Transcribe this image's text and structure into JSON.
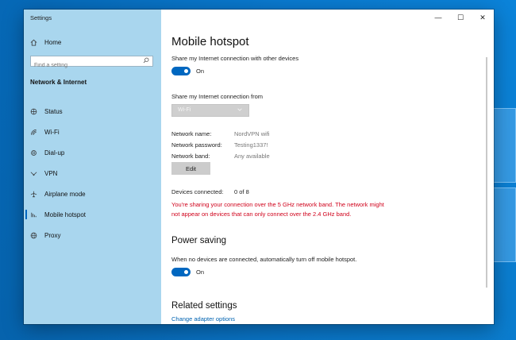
{
  "window": {
    "app_title": "Settings",
    "caption": {
      "minimize": "—",
      "maximize": "☐",
      "close": "✕"
    }
  },
  "sidebar": {
    "home_label": "Home",
    "search_placeholder": "Find a setting",
    "section_heading": "Network & Internet",
    "items": [
      {
        "label": "Status",
        "icon": "globe-status-icon",
        "selected": false
      },
      {
        "label": "Wi-Fi",
        "icon": "wifi-icon",
        "selected": false
      },
      {
        "label": "Dial-up",
        "icon": "dialup-icon",
        "selected": false
      },
      {
        "label": "VPN",
        "icon": "vpn-icon",
        "selected": false
      },
      {
        "label": "Airplane mode",
        "icon": "airplane-icon",
        "selected": false
      },
      {
        "label": "Mobile hotspot",
        "icon": "hotspot-icon",
        "selected": true
      },
      {
        "label": "Proxy",
        "icon": "globe-icon",
        "selected": false
      }
    ]
  },
  "main": {
    "title": "Mobile hotspot",
    "share_label": "Share my Internet connection with other devices",
    "share_toggle": "On",
    "share_from_label": "Share my Internet connection from",
    "share_from_value": "Wi-Fi",
    "network_name_key": "Network name:",
    "network_name_value": "NordVPN wifi",
    "network_password_key": "Network password:",
    "network_password_value": "Testing1337!",
    "network_band_key": "Network band:",
    "network_band_value": "Any available",
    "edit_label": "Edit",
    "devices_connected_key": "Devices connected:",
    "devices_connected_value": "0 of 8",
    "warning": "You're sharing your connection over the 5 GHz network band. The network might not appear on devices that can only connect over the 2.4 GHz band.",
    "power_saving_title": "Power saving",
    "power_saving_label": "When no devices are connected, automatically turn off mobile hotspot.",
    "power_saving_toggle": "On",
    "related_title": "Related settings",
    "related_link": "Change adapter options"
  },
  "colors": {
    "accent": "#0067c0",
    "sidebar_bg": "#a9d6ee",
    "warning": "#d0021b",
    "link": "#0063b1"
  }
}
